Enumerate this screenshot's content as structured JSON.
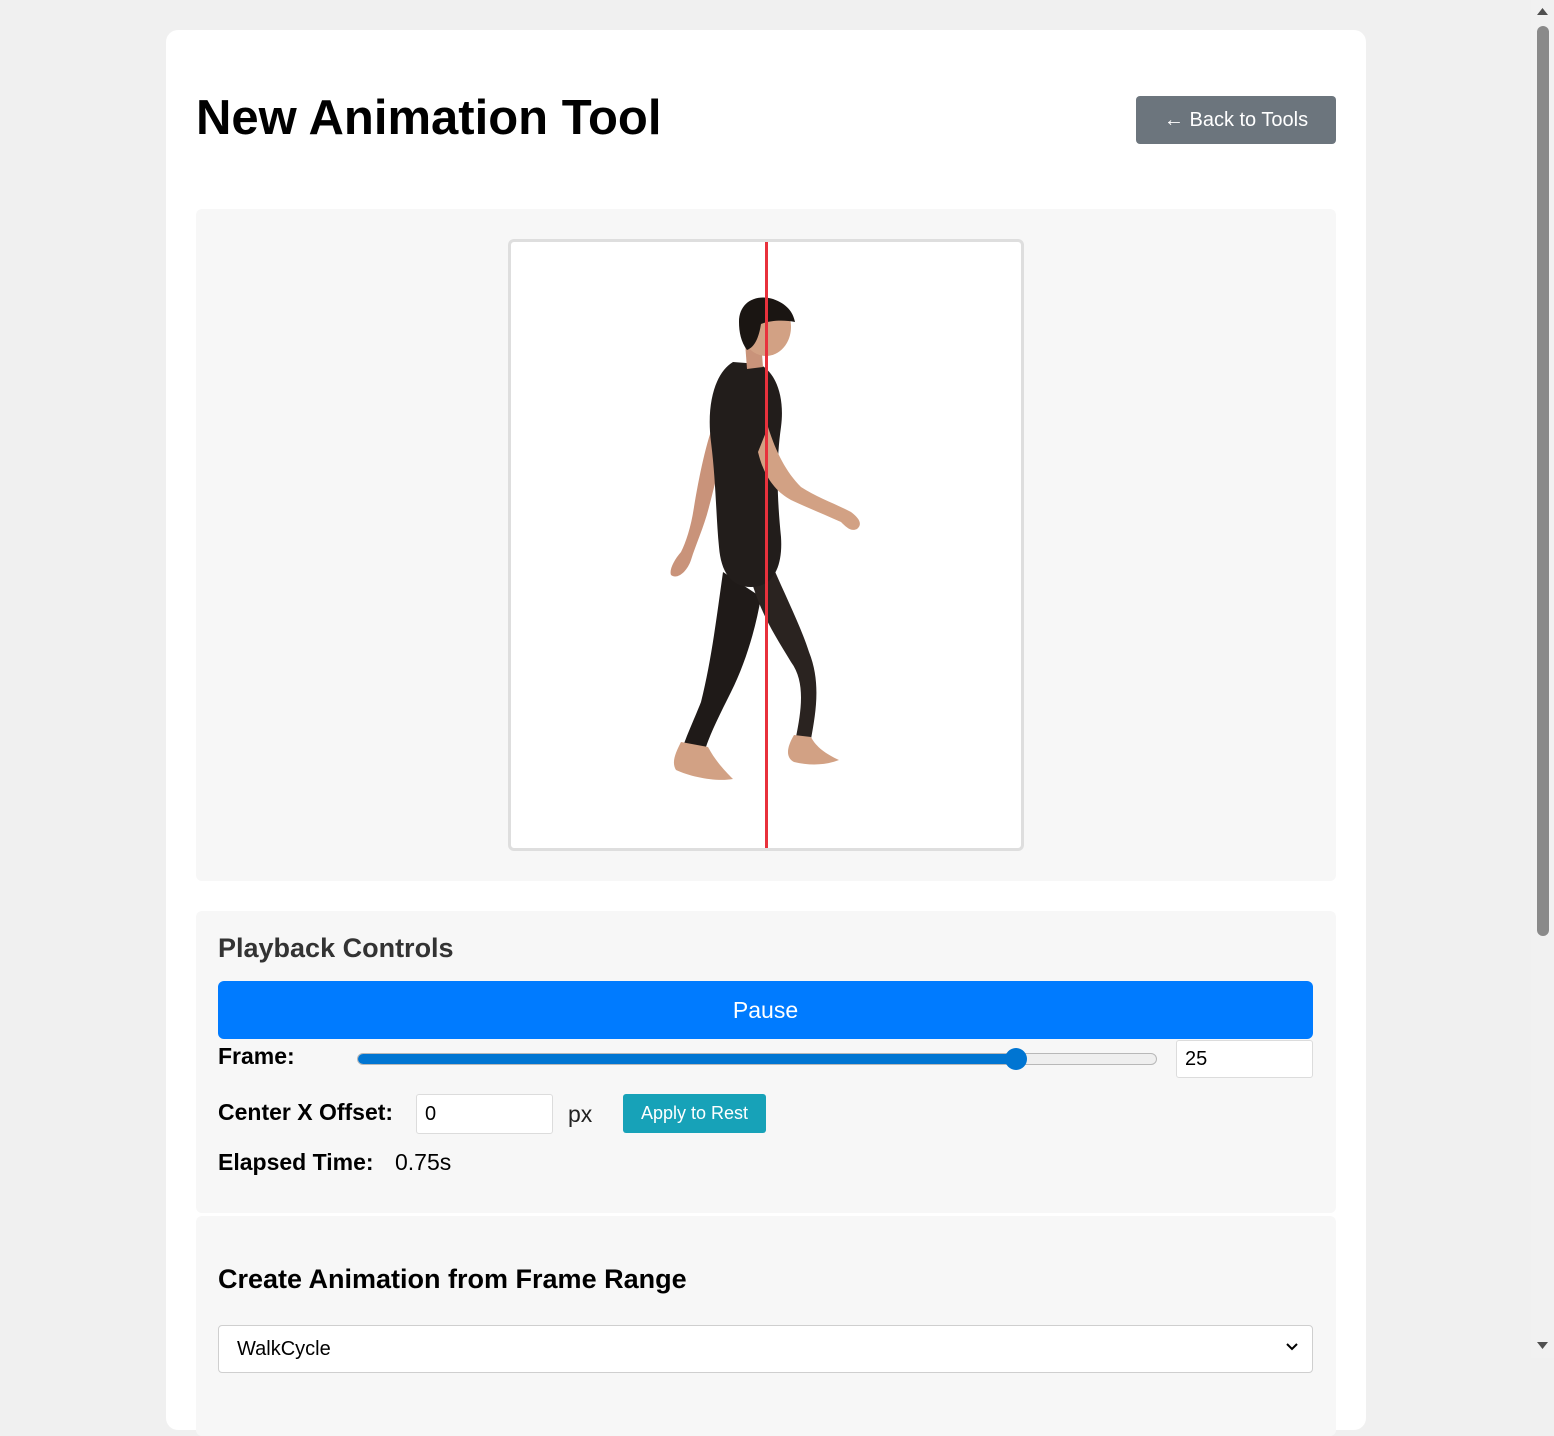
{
  "header": {
    "title": "New Animation Tool",
    "back_label": "← Back to Tools"
  },
  "playback": {
    "heading": "Playback Controls",
    "pause_label": "Pause",
    "frame_label": "Frame:",
    "frame_value": "25",
    "slider_fraction": 0.825,
    "offset_label": "Center X Offset:",
    "offset_value": "0",
    "offset_unit": "px",
    "apply_label": "Apply to Rest",
    "elapsed_label": "Elapsed Time:",
    "elapsed_value": "0.75s"
  },
  "create": {
    "heading": "Create Animation from Frame Range",
    "selected_animation": "WalkCycle"
  },
  "colors": {
    "primary": "#007bff",
    "secondary": "#6c757d",
    "info": "#17a2b8",
    "center_line": "#e8313c"
  }
}
